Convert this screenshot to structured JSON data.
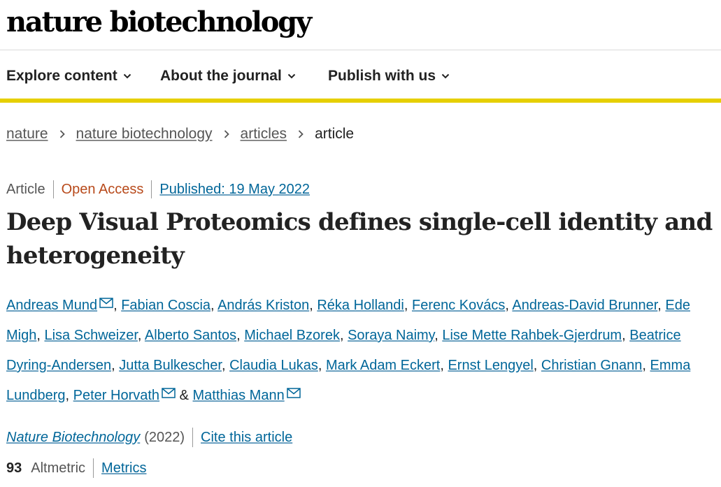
{
  "brand": {
    "title": "nature biotechnology"
  },
  "nav": {
    "items": [
      {
        "label": "Explore content"
      },
      {
        "label": "About the journal"
      },
      {
        "label": "Publish with us"
      }
    ]
  },
  "breadcrumb": {
    "items": [
      "nature",
      "nature biotechnology",
      "articles"
    ],
    "current": "article"
  },
  "article_meta": {
    "type": "Article",
    "access": "Open Access",
    "published": "Published: 19 May 2022"
  },
  "title": "Deep Visual Proteomics defines single-cell identity and heterogeneity",
  "authors": {
    "list": [
      "Andreas Mund",
      "Fabian Coscia",
      "András Kriston",
      "Réka Hollandi",
      "Ferenc Kovács",
      "Andreas-David Brunner",
      "Ede Migh",
      "Lisa Schweizer",
      "Alberto Santos",
      "Michael Bzorek",
      "Soraya Naimy",
      "Lise Mette Rahbek-Gjerdrum",
      "Beatrice Dyring-Andersen",
      "Jutta Bulkescher",
      "Claudia Lukas",
      "Mark Adam Eckert",
      "Ernst Lengyel",
      "Christian Gnann",
      "Emma Lundberg",
      "Peter Horvath",
      "Matthias Mann"
    ],
    "comma": ",",
    "ampersand": "&"
  },
  "citation": {
    "journal": "Nature Biotechnology",
    "year": "(2022)",
    "cite_label": "Cite this article"
  },
  "metrics": {
    "altmetric_score": "93",
    "altmetric_label": "Altmetric",
    "metrics_label": "Metrics"
  },
  "colors": {
    "link": "#006699",
    "open_access": "#b84a1b",
    "nav_border": "#e6cf00"
  },
  "icons": {
    "nav_dropdown": "chevron-down-icon",
    "breadcrumb_separator": "chevron-right-icon",
    "corresponding_author": "envelope-icon"
  }
}
